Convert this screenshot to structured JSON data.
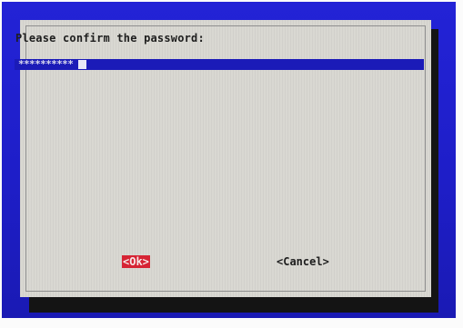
{
  "dialog": {
    "prompt": "Please confirm the password:",
    "password_field": {
      "value": "**********"
    },
    "buttons": {
      "ok_label": "<Ok>",
      "cancel_label": "<Cancel>"
    }
  },
  "colors": {
    "background": "#1e1ec8",
    "dialog": "#d9d8d2",
    "field": "#1b1bb8",
    "ok_highlight": "#d62434",
    "shadow": "#141414"
  }
}
